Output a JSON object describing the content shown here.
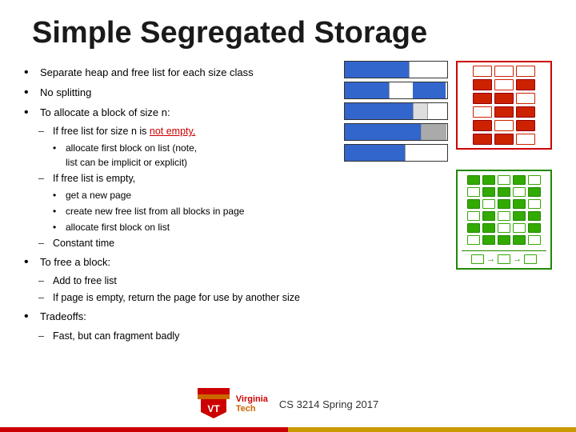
{
  "title": "Simple Segregated Storage",
  "bullets": {
    "main1": "Separate heap and free list for each size class",
    "main2": "No splitting",
    "main3": "To allocate a block of size n:",
    "sub1": "If free list for size n is not empty,",
    "sub1_label": "not empty,",
    "sub1_sub1": "allocate first block on list (note, list can be implicit or explicit)",
    "sub2": "If free list is empty,",
    "sub2_sub1": "get a new page",
    "sub2_sub2": "create new free list from all blocks in page",
    "sub2_sub3": "allocate first block on list",
    "sub3": "Constant time",
    "main4": "To free a block:",
    "sub4": "Add to free list",
    "sub5": "If page is empty, return the page for use by another size",
    "main5": "Tradeoffs:",
    "sub6": "Fast, but can fragment badly"
  },
  "footer": {
    "course": "CS 3214 Spring 2017"
  },
  "colors": {
    "accent_red": "#cc0000",
    "accent_blue": "#3366cc",
    "accent_green": "#228800",
    "accent_gold": "#cc9900"
  }
}
